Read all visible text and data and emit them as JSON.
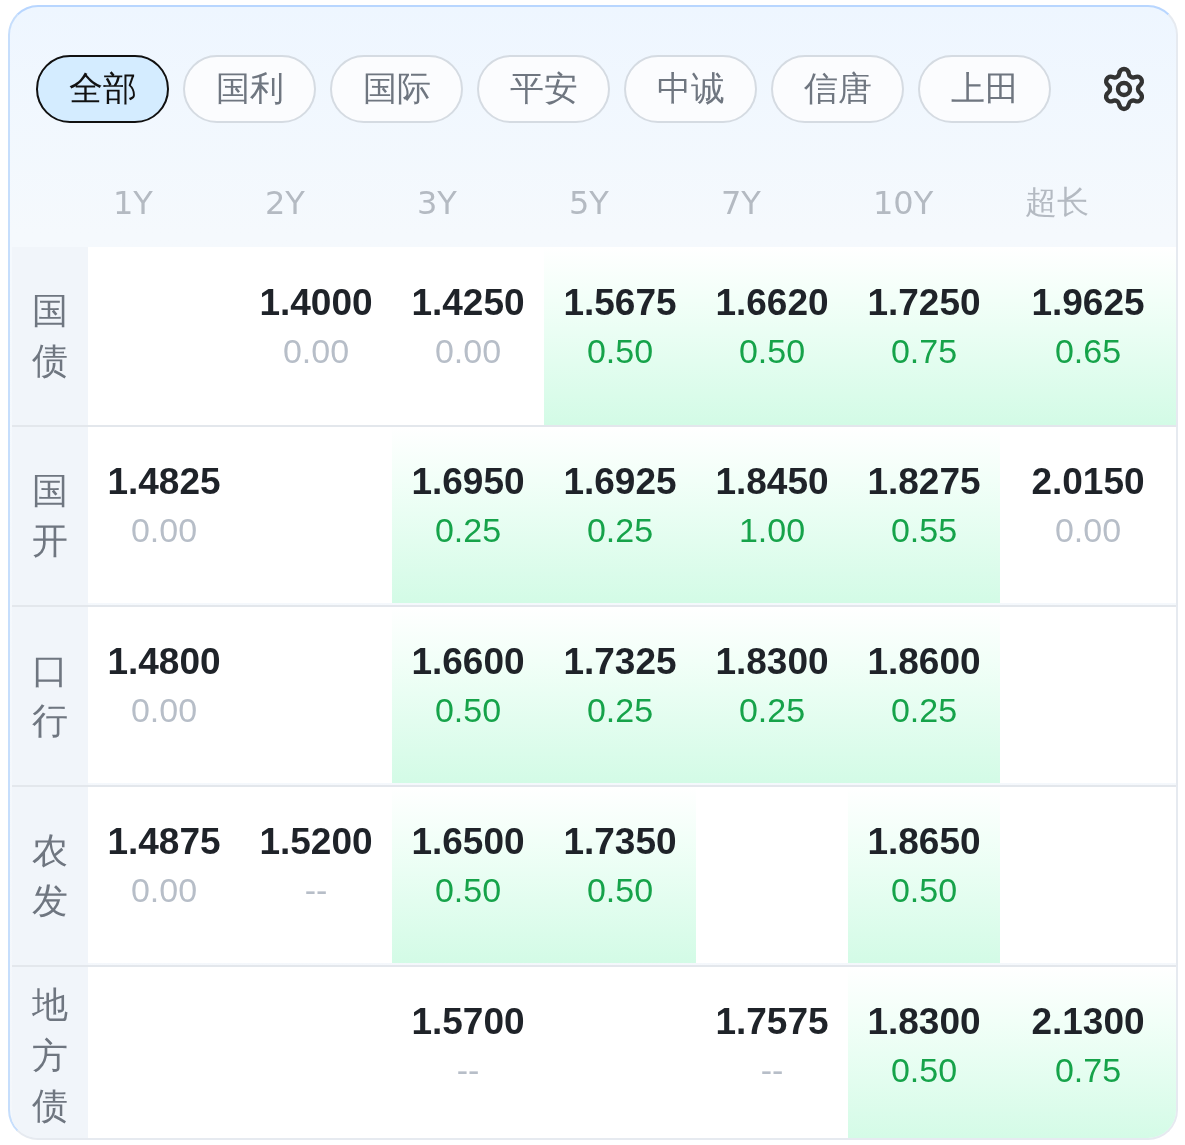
{
  "tabs": [
    {
      "label": "全部",
      "selected": true
    },
    {
      "label": "国利",
      "selected": false
    },
    {
      "label": "国际",
      "selected": false
    },
    {
      "label": "平安",
      "selected": false
    },
    {
      "label": "中诚",
      "selected": false
    },
    {
      "label": "信唐",
      "selected": false
    },
    {
      "label": "上田",
      "selected": false
    }
  ],
  "columns": [
    "1Y",
    "2Y",
    "3Y",
    "5Y",
    "7Y",
    "10Y",
    "超长"
  ],
  "rows": [
    {
      "label": "国债",
      "cells": [
        null,
        {
          "price": "1.4000",
          "change": "0.00",
          "highlight": false
        },
        {
          "price": "1.4250",
          "change": "0.00",
          "highlight": false
        },
        {
          "price": "1.5675",
          "change": "0.50",
          "highlight": true
        },
        {
          "price": "1.6620",
          "change": "0.50",
          "highlight": true
        },
        {
          "price": "1.7250",
          "change": "0.75",
          "highlight": true
        },
        {
          "price": "1.9625",
          "change": "0.65",
          "highlight": true
        }
      ]
    },
    {
      "label": "国开",
      "cells": [
        {
          "price": "1.4825",
          "change": "0.00",
          "highlight": false
        },
        null,
        {
          "price": "1.6950",
          "change": "0.25",
          "highlight": true
        },
        {
          "price": "1.6925",
          "change": "0.25",
          "highlight": true
        },
        {
          "price": "1.8450",
          "change": "1.00",
          "highlight": true
        },
        {
          "price": "1.8275",
          "change": "0.55",
          "highlight": true
        },
        {
          "price": "2.0150",
          "change": "0.00",
          "highlight": false
        }
      ]
    },
    {
      "label": "口行",
      "cells": [
        {
          "price": "1.4800",
          "change": "0.00",
          "highlight": false
        },
        null,
        {
          "price": "1.6600",
          "change": "0.50",
          "highlight": true
        },
        {
          "price": "1.7325",
          "change": "0.25",
          "highlight": true
        },
        {
          "price": "1.8300",
          "change": "0.25",
          "highlight": true
        },
        {
          "price": "1.8600",
          "change": "0.25",
          "highlight": true
        },
        null
      ]
    },
    {
      "label": "农发",
      "cells": [
        {
          "price": "1.4875",
          "change": "0.00",
          "highlight": false
        },
        {
          "price": "1.5200",
          "change": "--",
          "highlight": false
        },
        {
          "price": "1.6500",
          "change": "0.50",
          "highlight": true
        },
        {
          "price": "1.7350",
          "change": "0.50",
          "highlight": true
        },
        null,
        {
          "price": "1.8650",
          "change": "0.50",
          "highlight": true
        },
        null
      ]
    },
    {
      "label": "地方债",
      "cells": [
        null,
        null,
        {
          "price": "1.5700",
          "change": "--",
          "highlight": false
        },
        null,
        {
          "price": "1.7575",
          "change": "--",
          "highlight": false
        },
        {
          "price": "1.8300",
          "change": "0.50",
          "highlight": true
        },
        {
          "price": "2.1300",
          "change": "0.75",
          "highlight": true
        }
      ]
    }
  ]
}
